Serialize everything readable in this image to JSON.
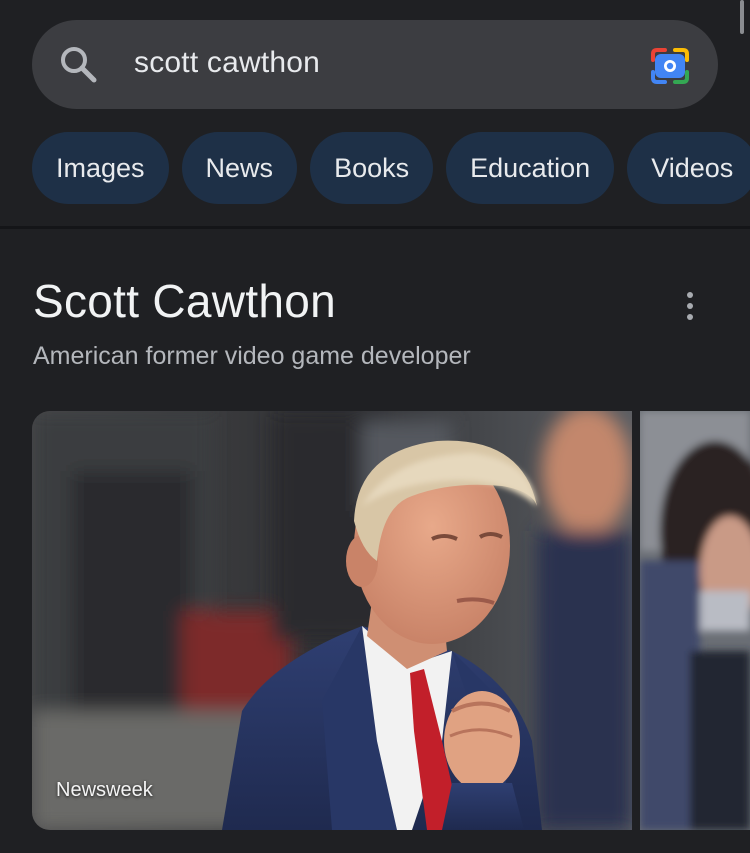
{
  "search": {
    "query": "scott cawthon",
    "search_icon": "search-icon",
    "lens_icon": "google-lens-icon"
  },
  "chips": [
    {
      "label": "Images"
    },
    {
      "label": "News"
    },
    {
      "label": "Books"
    },
    {
      "label": "Education"
    },
    {
      "label": "Videos"
    }
  ],
  "knowledge_panel": {
    "title": "Scott Cawthon",
    "subtitle": "American former video game developer",
    "more_icon": "more-vert-icon"
  },
  "images": [
    {
      "source": "Newsweek"
    },
    {
      "source": ""
    }
  ],
  "colors": {
    "background": "#1f2023",
    "search_bar": "#3c3d41",
    "chip_background": "#1e3047",
    "text_primary": "#e8eaed",
    "text_secondary": "#b4b7bc"
  }
}
